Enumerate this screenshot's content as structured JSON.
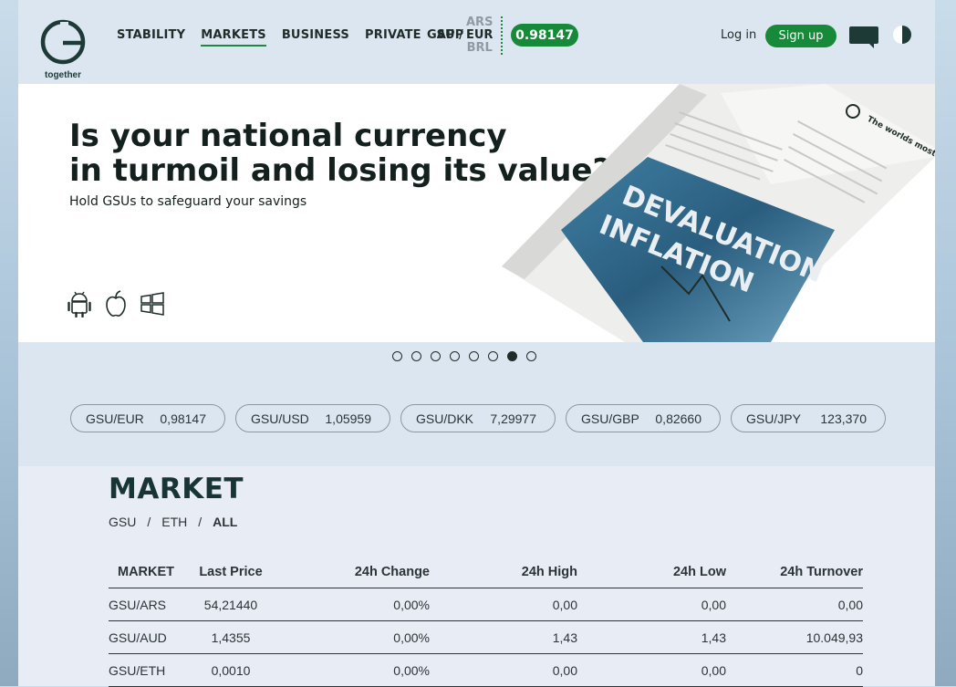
{
  "header": {
    "logo_text": "together",
    "nav": [
      "STABILITY",
      "MARKETS",
      "BUSINESS",
      "PRIVATE",
      "APP"
    ],
    "active_nav": "MARKETS",
    "gsu_label": "GSU /",
    "currencies": [
      "ARS",
      "EUR",
      "BRL"
    ],
    "selected_currency": "EUR",
    "rate": "0.98147",
    "login": "Log in",
    "signup": "Sign up"
  },
  "banner": {
    "headline_1": "Is your national currency",
    "headline_2": "in turmoil and losing its value?",
    "subline": "Hold GSUs to safeguard your savings",
    "app_icons": [
      "android-icon",
      "apple-icon",
      "windows-icon"
    ],
    "newspaper_text": [
      "DEVALUATION",
      "INFLATION",
      "The worlds most stable unit"
    ]
  },
  "carousel": {
    "total": 8,
    "active_index": 6
  },
  "ticker": [
    {
      "pair": "GSU/EUR",
      "value": "0,98147"
    },
    {
      "pair": "GSU/USD",
      "value": "1,05959"
    },
    {
      "pair": "GSU/DKK",
      "value": "7,29977"
    },
    {
      "pair": "GSU/GBP",
      "value": "0,82660"
    },
    {
      "pair": "GSU/JPY",
      "value": "123,370"
    }
  ],
  "market": {
    "title": "MARKET",
    "filters": [
      "GSU",
      "ETH",
      "ALL"
    ],
    "filter_sep": "/",
    "selected_filter": "ALL",
    "columns": [
      "MARKET",
      "Last Price",
      "24h Change",
      "24h High",
      "24h Low",
      "24h Turnover"
    ],
    "rows": [
      [
        "GSU/ARS",
        "54,21440",
        "0,00%",
        "0,00",
        "0,00",
        "0,00"
      ],
      [
        "GSU/AUD",
        "1,4355",
        "0,00%",
        "1,43",
        "1,43",
        "10.049,93"
      ],
      [
        "GSU/ETH",
        "0,0010",
        "0,00%",
        "0,00",
        "0,00",
        "0"
      ]
    ]
  },
  "colors": {
    "accent": "#178a3a",
    "dark": "#163534",
    "header_bg": "#dbe6f0"
  }
}
